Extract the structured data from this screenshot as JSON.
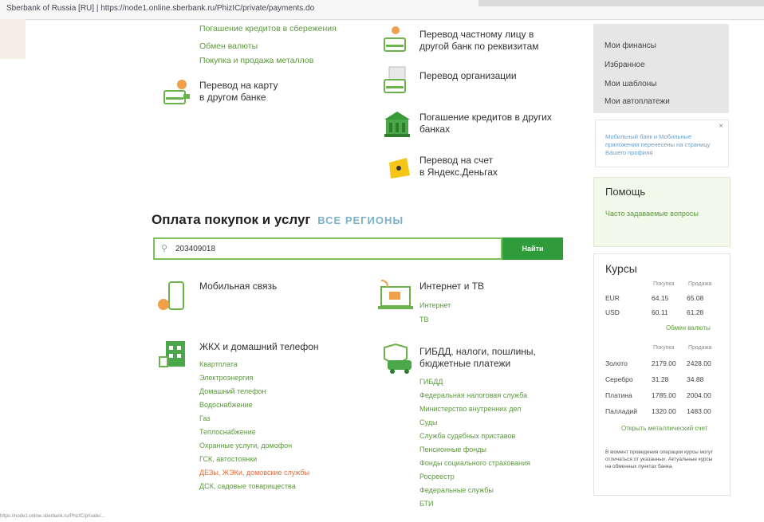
{
  "browser": {
    "url": "Sberbank of Russia [RU] | https://node1.online.sberbank.ru/PhizIC/private/payments.do"
  },
  "transfers_left": {
    "top_links": [
      "Погашение кредитов в сбережения",
      "Обмен валюты",
      "Покупка и продажа металлов"
    ],
    "card_transfer": {
      "title_line1": "Перевод на карту",
      "title_line2": "в другом банке"
    }
  },
  "transfers_right": {
    "private_person": {
      "line1": "Перевод частному лицу в",
      "line2": "другой банк по реквизитам"
    },
    "organization": {
      "line1": "Перевод организации"
    },
    "loans": {
      "line1": "Погашение кредитов в других",
      "line2": "банках"
    },
    "yandex": {
      "line1": "Перевод на счет",
      "line2": "в Яндекс.Деньгах"
    }
  },
  "search": {
    "heading": "Оплата покупок и услуг",
    "all_regions": "ВСЕ РЕГИОНЫ",
    "value": "203409018",
    "button": "Найти"
  },
  "services": {
    "mobile": {
      "title": "Мобильная связь"
    },
    "internet": {
      "title": "Интернет и ТВ",
      "links": [
        "Интернет",
        "ТВ"
      ]
    },
    "zhkh": {
      "title": "ЖКХ и домашний телефон",
      "links": [
        "Квартплата",
        "Электроэнергия",
        "Домашний телефон",
        "Водоснабжение",
        "Газ",
        "Теплоснабжение",
        "Охранные услуги, домофон",
        "ГСК, автостоянки",
        "ДЕЗы, ЖЭКи, домовские службы",
        "ДСК, садовые товарищества"
      ]
    },
    "gibdd": {
      "title_line1": "ГИБДД, налоги, пошлины,",
      "title_line2": "бюджетные платежи",
      "links": [
        "ГИБДД",
        "Федеральная налоговая служба",
        "Министерство внутренних дел",
        "Суды",
        "Служба судебных приставов",
        "Пенсионные фонды",
        "Фонды социального страхования",
        "Росреестр",
        "Федеральные службы",
        "БТИ"
      ]
    }
  },
  "sidebar": {
    "menu": [
      "Мои финансы",
      "Избранное",
      "Мои шаблоны",
      "Мои автоплатежи"
    ],
    "notice": {
      "close": "×",
      "text": "Мобильный банк и Мобильные приложения перенесены на страницу Вашего профиля"
    },
    "help": {
      "title": "Помощь",
      "link": "Часто задаваемые вопросы"
    },
    "rates": {
      "title": "Курсы",
      "col_buy": "Покупка",
      "col_sell": "Продажа",
      "currencies": [
        {
          "name": "EUR",
          "buy": "64.15",
          "sell": "65.08"
        },
        {
          "name": "USD",
          "buy": "60.11",
          "sell": "61.28"
        }
      ],
      "currency_link": "Обмен валюты",
      "metals": [
        {
          "name": "Золото",
          "buy": "2179.00",
          "sell": "2428.00"
        },
        {
          "name": "Серебро",
          "buy": "31.28",
          "sell": "34.88"
        },
        {
          "name": "Платина",
          "buy": "1785.00",
          "sell": "2004.00"
        },
        {
          "name": "Палладий",
          "buy": "1320.00",
          "sell": "1483.00"
        }
      ],
      "metals_link": "Открыть металлический счет",
      "fine_print": "В момент проведения операции курсы могут отличаться от указанных. Актуальные курсы на обменных пунктах банка."
    }
  },
  "status_bar": "https://node1.online.sberbank.ru/PhizIC/private/..."
}
